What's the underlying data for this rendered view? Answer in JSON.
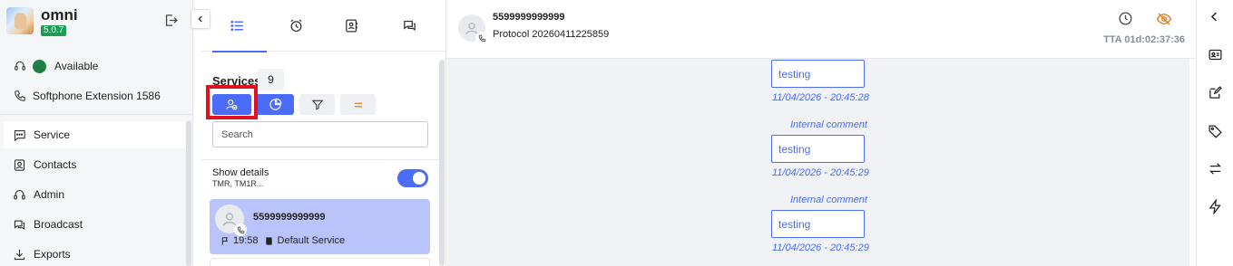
{
  "brand": {
    "name": "omni",
    "version": "5.0.7"
  },
  "sidebar": {
    "status": "Available",
    "extension": "Softphone Extension 1586",
    "nav": [
      {
        "label": "Service",
        "icon": "chat-icon",
        "active": true
      },
      {
        "label": "Contacts",
        "icon": "contact-card-icon",
        "active": false
      },
      {
        "label": "Admin",
        "icon": "admin-headset-icon",
        "active": false
      },
      {
        "label": "Broadcast",
        "icon": "broadcast-icon",
        "active": false
      },
      {
        "label": "Exports",
        "icon": "download-icon",
        "active": false
      }
    ],
    "status_color": "#1f7f45"
  },
  "services": {
    "tabs": [
      "list-icon",
      "alarm-clock-icon",
      "contact-book-icon",
      "chat-bubbles-icon"
    ],
    "title": "Services",
    "count": "9",
    "search_placeholder": "Search",
    "show_details_label": "Show details",
    "show_details_sub": "TMR, TM1R...",
    "show_details_on": true,
    "items": [
      {
        "name": "5599999999999",
        "time": "19:58",
        "queue": "Default Service",
        "selected": true
      }
    ]
  },
  "chat": {
    "contact": "5599999999999",
    "protocol": "Protocol 20260411225859",
    "tta": "TTA 01d:02:37:36",
    "messages": [
      {
        "label": "",
        "text": "testing",
        "timestamp": "11/04/2026 - 20:45:28"
      },
      {
        "label": "Internal comment",
        "text": "testing",
        "timestamp": "11/04/2026 - 20:45:29"
      },
      {
        "label": "Internal comment",
        "text": "testing",
        "timestamp": "11/04/2026 - 20:45:29"
      }
    ]
  },
  "colors": {
    "accent": "#4a6cf7",
    "highlight": "#e0121c",
    "selected_card": "#b9c4fa",
    "hide_icon": "#e07b1a"
  }
}
